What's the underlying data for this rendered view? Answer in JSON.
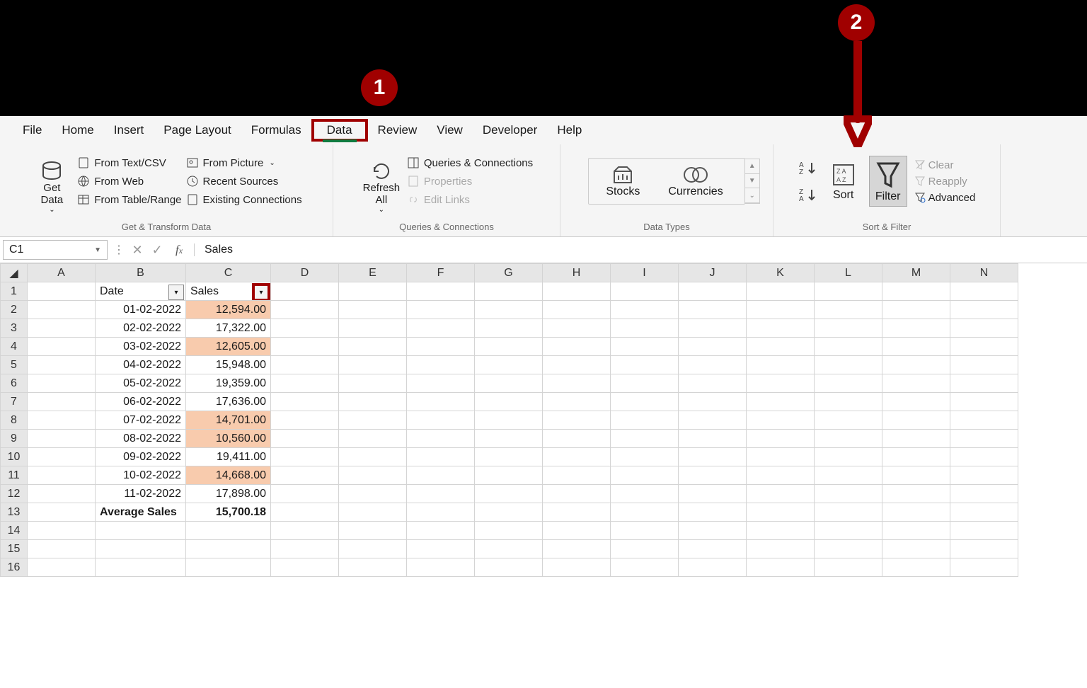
{
  "annotations": {
    "step1": "1",
    "step2": "2"
  },
  "tabs": [
    "File",
    "Home",
    "Insert",
    "Page Layout",
    "Formulas",
    "Data",
    "Review",
    "View",
    "Developer",
    "Help"
  ],
  "active_tab": "Data",
  "ribbon": {
    "get_transform": {
      "title": "Get & Transform Data",
      "get_data": "Get\nData",
      "from_text": "From Text/CSV",
      "from_web": "From Web",
      "from_table": "From Table/Range",
      "from_picture": "From Picture",
      "recent_sources": "Recent Sources",
      "existing": "Existing Connections"
    },
    "queries": {
      "title": "Queries & Connections",
      "refresh": "Refresh\nAll",
      "qc": "Queries & Connections",
      "props": "Properties",
      "edit_links": "Edit Links"
    },
    "data_types": {
      "title": "Data Types",
      "stocks": "Stocks",
      "currencies": "Currencies"
    },
    "sort_filter": {
      "title": "Sort & Filter",
      "sort": "Sort",
      "filter": "Filter",
      "clear": "Clear",
      "reapply": "Reapply",
      "advanced": "Advanced"
    }
  },
  "formula_bar": {
    "name_box": "C1",
    "value": "Sales"
  },
  "columns": [
    "A",
    "B",
    "C",
    "D",
    "E",
    "F",
    "G",
    "H",
    "I",
    "J",
    "K",
    "L",
    "M",
    "N"
  ],
  "headers": {
    "date": "Date",
    "sales": "Sales"
  },
  "rows": [
    {
      "n": 1
    },
    {
      "n": 2,
      "date": "01-02-2022",
      "sales": "12,594.00",
      "hl": true
    },
    {
      "n": 3,
      "date": "02-02-2022",
      "sales": "17,322.00",
      "hl": false
    },
    {
      "n": 4,
      "date": "03-02-2022",
      "sales": "12,605.00",
      "hl": true
    },
    {
      "n": 5,
      "date": "04-02-2022",
      "sales": "15,948.00",
      "hl": false
    },
    {
      "n": 6,
      "date": "05-02-2022",
      "sales": "19,359.00",
      "hl": false
    },
    {
      "n": 7,
      "date": "06-02-2022",
      "sales": "17,636.00",
      "hl": false
    },
    {
      "n": 8,
      "date": "07-02-2022",
      "sales": "14,701.00",
      "hl": true
    },
    {
      "n": 9,
      "date": "08-02-2022",
      "sales": "10,560.00",
      "hl": true
    },
    {
      "n": 10,
      "date": "09-02-2022",
      "sales": "19,411.00",
      "hl": false
    },
    {
      "n": 11,
      "date": "10-02-2022",
      "sales": "14,668.00",
      "hl": true
    },
    {
      "n": 12,
      "date": "11-02-2022",
      "sales": "17,898.00",
      "hl": false
    }
  ],
  "summary": {
    "label": "Average Sales",
    "value": "15,700.18"
  }
}
